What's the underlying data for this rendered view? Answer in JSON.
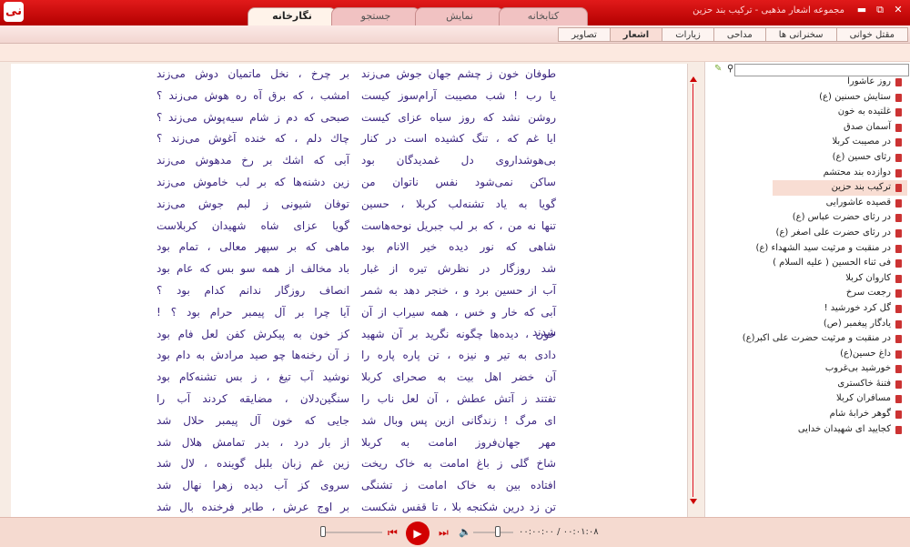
{
  "app": {
    "logo": "نی",
    "title": "مجموعه اشعار مذهبی - ترکیب بند حزین"
  },
  "main_tabs": [
    "نگارخانه",
    "جستجو",
    "نمایش",
    "کتابخانه"
  ],
  "sub_tabs": [
    "مقتل خوانی",
    "سخنرانی ها",
    "مداحی",
    "زیارات",
    "اشعار",
    "تصاویر"
  ],
  "active_sub_tab": "اشعار",
  "poem": {
    "right_column": [
      "طوفان خون ز چشم جهان جوش می‌زند",
      "یا رب ! شب مصیبت آرام‌سوز کیست",
      "روشن نشد که روز سیاه عزای کیست",
      "ایا غم که ، تنگ کشیده است در کنار",
      "بی‌هوشداروی دل غمدیدگان بود",
      "ساکن نمی‌شود نفس ناتوان من",
      "گویا به یاد تشنه‌لب کربلا ، حسین",
      "تنها نه من ، که بر لب جبریل نوحه‌هاست",
      "شاهی که نور دیده خیر الانام بود",
      "شد روزگار در نظرش تیره از غبار",
      "آب از حسین برد و ، خنجر دهد به شمر",
      "آبی که خار و خس ، همه سیراب از آن شدند",
      "خون ، دیده‌ها چگونه نگرید بر آن شهید",
      "دادی به تیر و نیزه ، تن پاره پاره را",
      "آن خضر اهل بیت به صحرای کربلا",
      "تفتند ز آتش عطش ، آن لعل ناب را",
      "ای مرگ ! زندگانی ازین پس وبال شد",
      "مهر جهان‌فروز امامت به کربلا",
      "شاخ گلی ز باغ امامت به خاک ریخت",
      "افتاده بین به خاک امامت ز تشنگی",
      "تن زد درین شکنجه بلا ، تا قفس شکست"
    ],
    "left_column": [
      "بر چرخ ، نخل ماتمیان دوش می‌زند",
      "امشب ، که برق آه ره هوش می‌زند ؟",
      "صبحی که دم ز شام سیه‌پوش می‌زند ؟",
      "چاك دلم ، که خنده آغوش می‌زند ؟",
      "آبی که اشك بر رخ مدهوش می‌زند",
      "زین دشنه‌ها که بر لب خاموش می‌زند",
      "توفان شیونی ز لبم جوش می‌زند",
      "گویا عزای شاه شهیدان کربلاست",
      "ماهی که بر سپهر معالی ، تمام بود",
      "باد مخالف از همه سو بس که عام بود",
      "انصاف روزگار ندانم کدام بود ؟",
      "آیا چرا بر آل پیمبر حرام بود ؟ !",
      "کز خون به پیکرش کفن لعل فام بود",
      "ز آن رخنه‌ها چو صید مرادش به دام بود",
      "نوشید آب تیغ ، ز بس تشنه‌کام بود",
      "سنگین‌دلان ، مضایقه کردند آب را",
      "جایی که خون آل پیمبر حلال شد",
      "از بار درد ، بدر تمامش هلال شد",
      "زین غم زبان بلبل گوینده ، لال شد",
      "سروی کز آب دیده زهرا نهال شد",
      "بر اوج عرش ، طایر فرخنده بال شد"
    ]
  },
  "sidebar": {
    "search_placeholder": "",
    "search_icon": "search-icon",
    "items": [
      "روز عاشورا",
      "ستایش حسنین (ع)",
      "غلتیده به خون",
      "آسمان صدق",
      "در مصیبت کربلا",
      "رثای حسین (ع)",
      "دوازده بند محتشم",
      "ترکیب بند حزین",
      "قصیده عاشورایی",
      "در رثای حضرت عباس (ع)",
      "در رثای حضرت علی اصغر (ع)",
      "در منقبت و مرثیت سید الشهداء (ع)",
      "فی ثناء الحسین ( علیه السلام )",
      "کاروان کربلا",
      "رجعت سرخ",
      "گل کرد خورشید !",
      "یادگار پیغمبر (ص)",
      "در منقبت و مرثیت حضرت علی اکبر(ع)",
      "داغ حسین(ع)",
      "خورشید بی‌غروب",
      "فتنهٔ خاکستری",
      "مسافران کربلا",
      "گوهر خرابهٔ شام",
      "کجایید ای شهیدان خدایی"
    ],
    "selected_index": 7
  },
  "player": {
    "time": "۰۰:۰۰:۰۰ / ۰۰:۰۱:۰۸",
    "progress": 0,
    "volume": 0.2
  },
  "colors": {
    "accent": "#d20000",
    "poem_text": "#3c2680",
    "selected_item": "#f8ddd3"
  }
}
